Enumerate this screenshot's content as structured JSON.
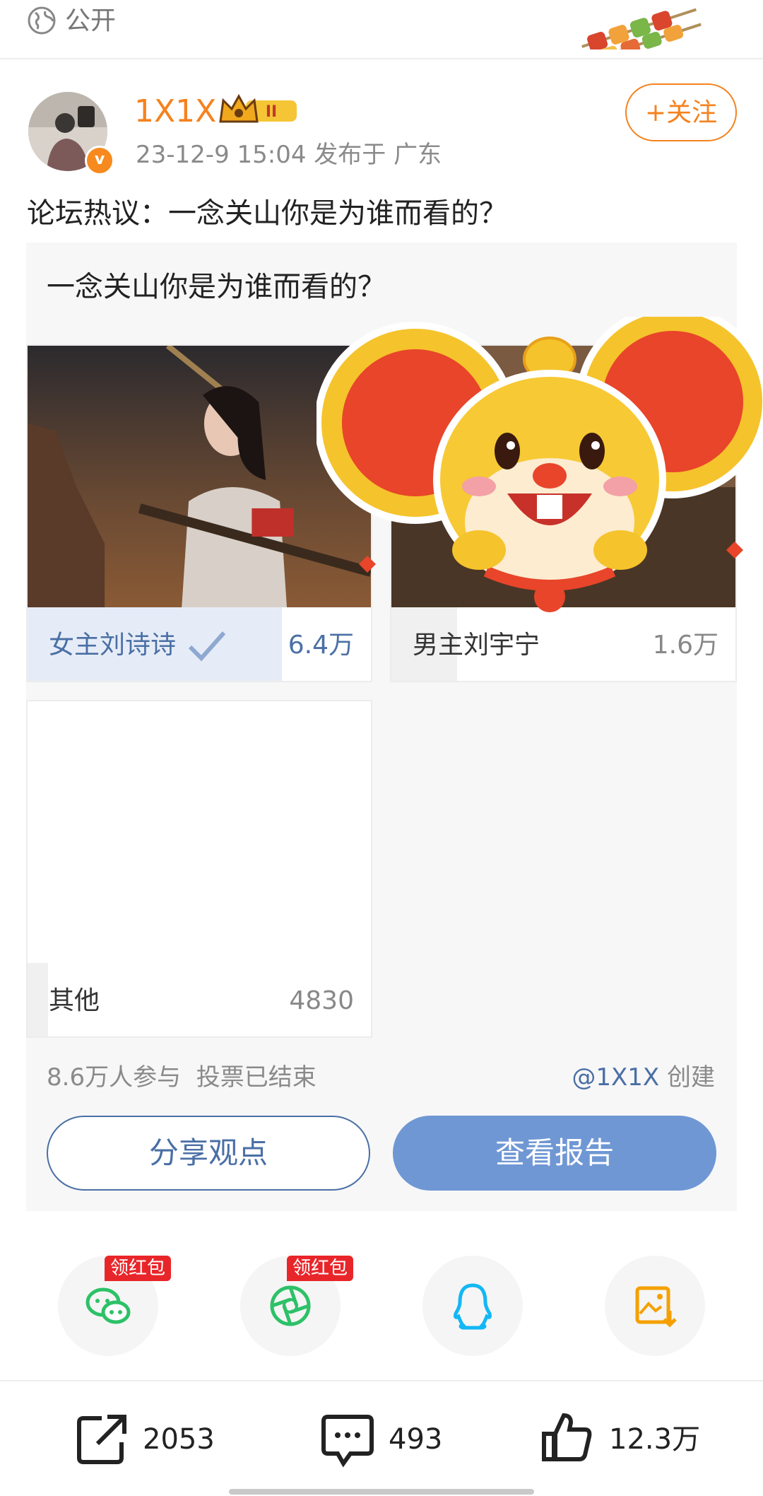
{
  "top": {
    "visibility": "公开"
  },
  "post": {
    "username": "1X1X",
    "level_badge": "II",
    "meta": "23-12-9 15:04  发布于 广东",
    "follow_label": "+关注",
    "text": "论坛热议：一念关山你是为谁而看的？"
  },
  "poll": {
    "question": "一念关山你是为谁而看的？",
    "options": [
      {
        "label": "女主刘诗诗",
        "count": "6.4万",
        "selected": true,
        "share": 0.74
      },
      {
        "label": "男主刘宇宁",
        "count": "1.6万",
        "selected": false,
        "share": 0.19
      },
      {
        "label": "其他",
        "count": "4830",
        "selected": false,
        "share": 0.06
      }
    ],
    "participants": "8.6万人参与",
    "status": "投票已结束",
    "creator_handle": "@1X1X",
    "creator_suffix": " 创建",
    "share_button": "分享观点",
    "report_button": "查看报告"
  },
  "share_row": {
    "items": [
      {
        "icon": "wechat-icon",
        "tag": "领红包",
        "color": "#2dc168"
      },
      {
        "icon": "moments-icon",
        "tag": "领红包",
        "color": "#2dc168"
      },
      {
        "icon": "qq-icon",
        "tag": "",
        "color": "#12b7f5"
      },
      {
        "icon": "save-image-icon",
        "tag": "",
        "color": "#f5a000"
      }
    ]
  },
  "actions": {
    "reposts": "2053",
    "comments": "493",
    "likes": "12.3万"
  },
  "colors": {
    "accent_orange": "#f5821f",
    "poll_blue": "#4a6fa5",
    "report_button": "#6f97d4"
  }
}
